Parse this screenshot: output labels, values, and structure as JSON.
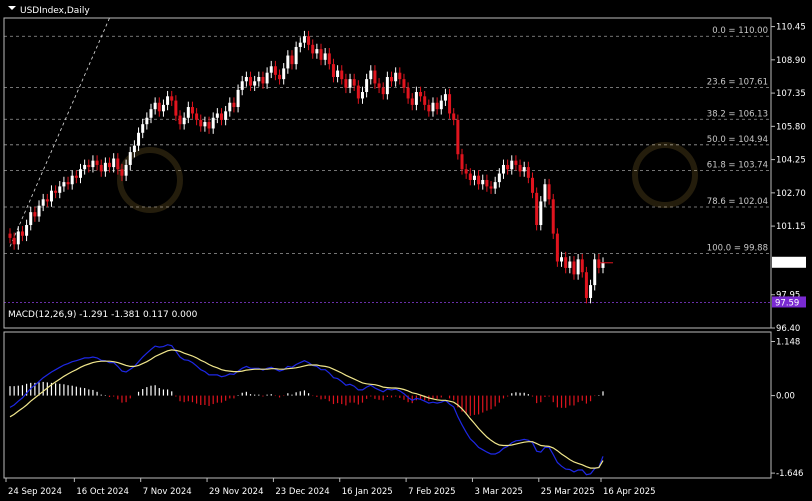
{
  "window": {
    "symbol_title": "USDIndex,Daily",
    "indicator_title": "MACD(12,26,9) -1.291 -1.381 0.117 0.000"
  },
  "colors": {
    "background": "#000000",
    "bull": "#ffffff",
    "bear": "#e0141e",
    "grid": "#9a9a9a",
    "macd_line": "#1e28e6",
    "signal_line": "#f0e68c",
    "hist_pos": "#ffffff",
    "hist_neg": "#e0141e",
    "current_price_bg": "#ffffff",
    "low_price_bg": "#7a2ad2"
  },
  "price_axis": {
    "ticks": [
      "110.45",
      "108.90",
      "107.35",
      "105.80",
      "104.25",
      "102.70",
      "101.15",
      "97.95",
      "96.40"
    ],
    "current_price": "99.44",
    "low_marker": "97.59"
  },
  "fibonacci": [
    {
      "label": "0.0 = 110.00",
      "price": 110.0
    },
    {
      "label": "23.6 = 107.61",
      "price": 107.61
    },
    {
      "label": "38.2 = 106.13",
      "price": 106.13
    },
    {
      "label": "50.0 = 104.94",
      "price": 104.94
    },
    {
      "label": "61.8 = 103.74",
      "price": 103.74
    },
    {
      "label": "78.6 = 102.04",
      "price": 102.04
    },
    {
      "label": "100.0 = 99.88",
      "price": 99.88
    }
  ],
  "macd_axis": {
    "ticks": [
      "1.148",
      "0.00",
      "-1.646"
    ]
  },
  "time_axis": {
    "labels": [
      "24 Sep 2024",
      "16 Oct 2024",
      "7 Nov 2024",
      "29 Nov 2024",
      "23 Dec 2024",
      "16 Jan 2025",
      "7 Feb 2025",
      "3 Mar 2025",
      "25 Mar 2025",
      "16 Apr 2025"
    ]
  },
  "chart_data": {
    "type": "candlestick",
    "symbol": "USDIndex",
    "timeframe": "Daily",
    "price_range": [
      96.4,
      110.85
    ],
    "macd_range": [
      -1.75,
      1.35
    ],
    "closes": [
      100.6,
      100.3,
      100.9,
      100.7,
      101.2,
      101.8,
      101.6,
      102.1,
      102.4,
      102.3,
      102.8,
      102.7,
      103.0,
      103.2,
      103.1,
      103.5,
      103.4,
      103.8,
      104.0,
      103.9,
      104.2,
      104.0,
      103.7,
      104.1,
      103.9,
      104.3,
      103.8,
      103.5,
      104.0,
      104.6,
      104.9,
      105.5,
      105.9,
      106.2,
      106.6,
      106.9,
      106.5,
      106.8,
      107.2,
      107.0,
      106.3,
      105.9,
      106.2,
      106.7,
      106.4,
      106.1,
      105.8,
      106.0,
      105.7,
      106.2,
      106.4,
      106.1,
      106.5,
      106.9,
      106.7,
      107.5,
      107.9,
      108.1,
      107.7,
      107.9,
      108.1,
      107.8,
      108.3,
      108.6,
      108.2,
      108.0,
      108.5,
      109.1,
      108.7,
      109.5,
      109.7,
      110.0,
      109.6,
      109.2,
      109.4,
      108.9,
      109.2,
      108.7,
      108.1,
      108.4,
      108.0,
      107.6,
      108.0,
      107.7,
      107.1,
      107.4,
      108.0,
      108.4,
      107.8,
      107.6,
      107.3,
      108.1,
      107.9,
      108.3,
      108.0,
      107.6,
      107.1,
      106.8,
      107.4,
      107.2,
      106.8,
      106.5,
      106.9,
      106.6,
      107.0,
      107.3,
      106.4,
      106.1,
      104.5,
      103.8,
      103.6,
      103.3,
      103.5,
      103.1,
      103.3,
      103.0,
      102.9,
      103.2,
      103.6,
      104.0,
      103.8,
      104.2,
      104.0,
      103.7,
      103.9,
      103.4,
      102.7,
      101.2,
      102.3,
      103.1,
      102.4,
      100.8,
      99.5,
      99.7,
      99.2,
      99.5,
      98.9,
      99.6,
      99.0,
      97.8,
      98.4,
      99.6,
      99.2,
      99.44
    ],
    "macd": [
      -0.25,
      -0.2,
      -0.12,
      -0.05,
      0.05,
      0.15,
      0.22,
      0.3,
      0.38,
      0.44,
      0.5,
      0.55,
      0.6,
      0.65,
      0.68,
      0.72,
      0.74,
      0.77,
      0.8,
      0.8,
      0.82,
      0.8,
      0.75,
      0.74,
      0.7,
      0.7,
      0.62,
      0.52,
      0.5,
      0.56,
      0.62,
      0.72,
      0.82,
      0.9,
      0.98,
      1.05,
      1.03,
      1.04,
      1.08,
      1.06,
      0.94,
      0.82,
      0.76,
      0.75,
      0.7,
      0.63,
      0.55,
      0.51,
      0.44,
      0.44,
      0.44,
      0.4,
      0.42,
      0.46,
      0.45,
      0.52,
      0.58,
      0.62,
      0.58,
      0.58,
      0.58,
      0.54,
      0.58,
      0.6,
      0.56,
      0.52,
      0.55,
      0.62,
      0.6,
      0.66,
      0.7,
      0.74,
      0.7,
      0.64,
      0.62,
      0.55,
      0.55,
      0.48,
      0.38,
      0.36,
      0.3,
      0.22,
      0.24,
      0.2,
      0.12,
      0.12,
      0.18,
      0.22,
      0.16,
      0.12,
      0.08,
      0.14,
      0.12,
      0.14,
      0.1,
      0.04,
      -0.04,
      -0.1,
      -0.06,
      -0.08,
      -0.12,
      -0.16,
      -0.14,
      -0.16,
      -0.14,
      -0.1,
      -0.18,
      -0.24,
      -0.45,
      -0.62,
      -0.78,
      -0.92,
      -1.0,
      -1.1,
      -1.15,
      -1.2,
      -1.24,
      -1.24,
      -1.2,
      -1.12,
      -1.08,
      -1.0,
      -0.96,
      -0.95,
      -0.93,
      -0.95,
      -1.0,
      -1.18,
      -1.2,
      -1.1,
      -1.1,
      -1.25,
      -1.42,
      -1.5,
      -1.56,
      -1.57,
      -1.62,
      -1.58,
      -1.58,
      -1.68,
      -1.66,
      -1.55,
      -1.52,
      -1.29
    ],
    "signal": [
      -0.45,
      -0.4,
      -0.33,
      -0.27,
      -0.2,
      -0.12,
      -0.05,
      0.02,
      0.09,
      0.16,
      0.23,
      0.29,
      0.35,
      0.41,
      0.46,
      0.51,
      0.55,
      0.6,
      0.64,
      0.67,
      0.7,
      0.72,
      0.73,
      0.73,
      0.73,
      0.72,
      0.7,
      0.67,
      0.64,
      0.62,
      0.62,
      0.64,
      0.68,
      0.72,
      0.77,
      0.83,
      0.87,
      0.91,
      0.95,
      0.97,
      0.96,
      0.94,
      0.9,
      0.87,
      0.84,
      0.8,
      0.75,
      0.71,
      0.66,
      0.62,
      0.59,
      0.55,
      0.53,
      0.52,
      0.51,
      0.51,
      0.52,
      0.54,
      0.55,
      0.56,
      0.56,
      0.56,
      0.56,
      0.57,
      0.57,
      0.56,
      0.56,
      0.57,
      0.58,
      0.59,
      0.61,
      0.63,
      0.65,
      0.65,
      0.65,
      0.63,
      0.62,
      0.6,
      0.56,
      0.52,
      0.48,
      0.43,
      0.39,
      0.35,
      0.31,
      0.27,
      0.25,
      0.24,
      0.23,
      0.21,
      0.18,
      0.17,
      0.16,
      0.16,
      0.15,
      0.13,
      0.1,
      0.06,
      0.04,
      0.01,
      -0.02,
      -0.05,
      -0.07,
      -0.09,
      -0.1,
      -0.1,
      -0.12,
      -0.14,
      -0.2,
      -0.28,
      -0.38,
      -0.49,
      -0.59,
      -0.7,
      -0.79,
      -0.88,
      -0.95,
      -1.01,
      -1.05,
      -1.06,
      -1.06,
      -1.05,
      -1.03,
      -1.01,
      -0.99,
      -0.98,
      -0.98,
      -1.02,
      -1.06,
      -1.07,
      -1.08,
      -1.11,
      -1.17,
      -1.24,
      -1.3,
      -1.36,
      -1.41,
      -1.44,
      -1.47,
      -1.51,
      -1.54,
      -1.54,
      -1.53,
      -1.38
    ]
  }
}
